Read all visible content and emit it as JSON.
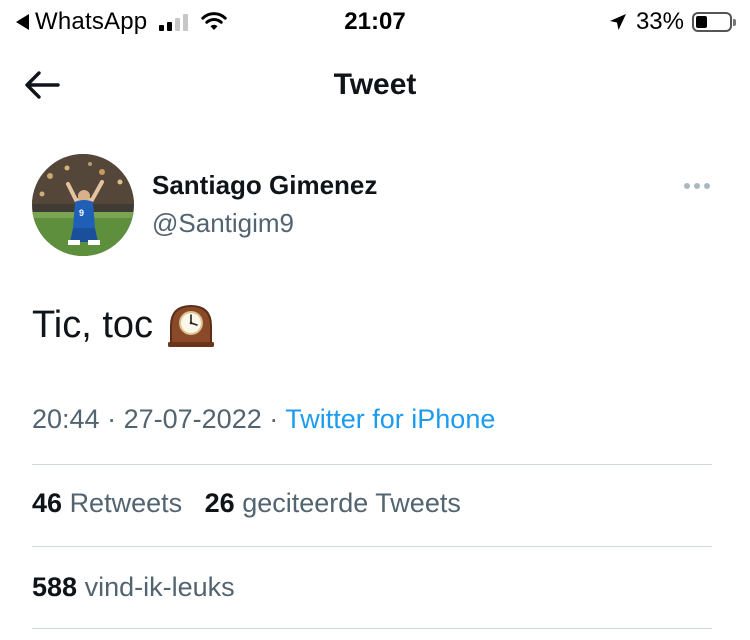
{
  "status_bar": {
    "back_app": "WhatsApp",
    "time": "21:07",
    "battery_percent": "33%",
    "battery_level": 0.33,
    "signal_bars": 2
  },
  "header": {
    "title": "Tweet",
    "back_icon": "arrow-left-icon"
  },
  "tweet": {
    "author_name": "Santiago Gimenez",
    "author_handle": "@Santigim9",
    "text": "Tic, toc",
    "emoji_icon": "mantelpiece-clock-icon",
    "time": "20:44",
    "separator": "·",
    "date": "27-07-2022",
    "source": "Twitter for iPhone"
  },
  "stats": {
    "retweets_count": "46",
    "retweets_label": "Retweets",
    "quotes_count": "26",
    "quotes_label": "geciteerde Tweets",
    "likes_count": "588",
    "likes_label": "vind-ik-leuks"
  },
  "colors": {
    "link": "#1d9bf0",
    "secondary_text": "#536471",
    "divider": "#cfd9de"
  }
}
